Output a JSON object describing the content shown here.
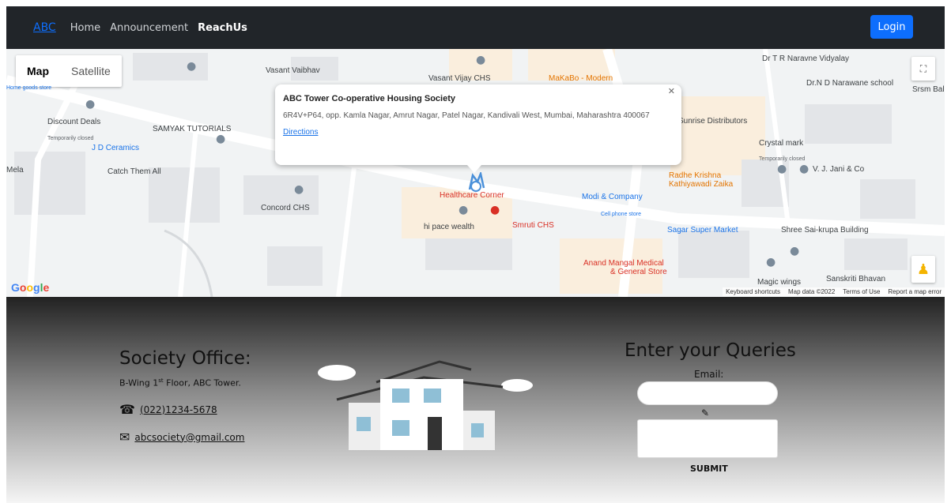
{
  "navbar": {
    "brand": "ABC",
    "links": [
      "Home",
      "Announcement",
      "ReachUs"
    ],
    "login_label": "Login"
  },
  "map": {
    "type_map": "Map",
    "type_satellite": "Satellite",
    "labels": {
      "vasant_vaibhav": "Vasant Vaibhav",
      "vasant_vijay": "Vasant Vijay CHS",
      "makabo": "MaKaBo - Modern",
      "dr_naravne": "Dr T R Naravne Vidyalay",
      "dr_nd": "Dr.N D Narawane school",
      "srsm": "Srsm Bal",
      "home_goods": "Home goods store",
      "discount_deals": "Discount Deals",
      "temp_closed": "Temporarily closed",
      "samyak": "SAMYAK TUTORIALS",
      "jd_ceramics": "J D Ceramics",
      "mela": "Mela",
      "catch_them": "Catch Them All",
      "concord": "Concord CHS",
      "healthcare": "Healthcare Corner",
      "hi_pace": "hi pace wealth",
      "smruti": "Smruti CHS",
      "sunrise": "Sunrise Distributors",
      "crystal": "Crystal mark",
      "vj_jani": "V. J. Jani & Co",
      "radhe": "Radhe Krishna",
      "kathiyawadi": "Kathiyawadi Zaika",
      "modi": "Modi & Company",
      "cell_phone": "Cell phone store",
      "sagar": "Sagar Super Market",
      "shree_sai": "Shree Sai-krupa Building",
      "anand": "Anand Mangal Medical",
      "general_store": "& General Store",
      "magic": "Magic wings",
      "sanskriti": "Sanskriti Bhavan"
    },
    "footer": {
      "shortcuts": "Keyboard shortcuts",
      "data": "Map data ©2022",
      "terms": "Terms of Use",
      "report": "Report a map error"
    },
    "infowindow": {
      "title": "ABC Tower Co-operative Housing Society",
      "address": "6R4V+P64, opp. Kamla Nagar, Amrut Nagar, Patel Nagar, Kandivali West, Mumbai, Maharashtra 400067",
      "directions": "Directions"
    }
  },
  "office": {
    "title": "Society Office:",
    "address_prefix": "B-Wing 1",
    "address_sup": "st",
    "address_suffix": " Floor, ABC Tower.",
    "phone": "(022)1234-5678",
    "email": "abcsociety@gmail.com"
  },
  "queries": {
    "title": "Enter your Queries",
    "email_label": "Email:",
    "submit_label": "SUBMIT"
  }
}
